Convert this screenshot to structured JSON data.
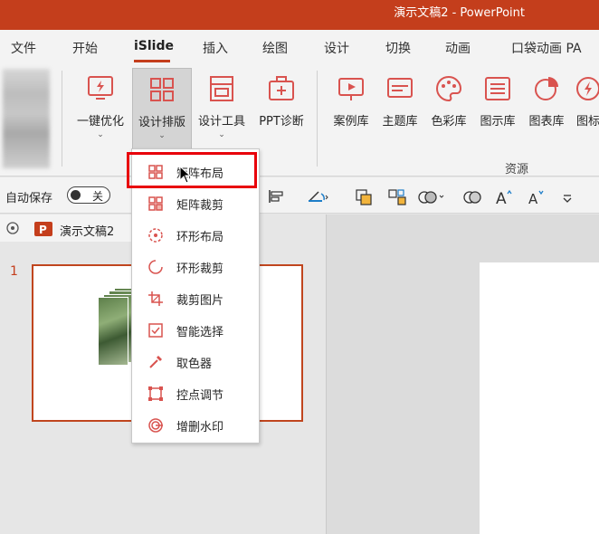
{
  "window": {
    "title": "演示文稿2 - PowerPoint"
  },
  "menu_tabs": [
    "文件",
    "开始",
    "iSlide",
    "插入",
    "绘图",
    "设计",
    "切换",
    "动画",
    "口袋动画 PA"
  ],
  "active_tab": "iSlide",
  "ribbon": {
    "buttons": [
      {
        "label": "一键优化",
        "icon": "lightning-icon"
      },
      {
        "label": "设计排版",
        "icon": "layout-grid-icon"
      },
      {
        "label": "设计工具",
        "icon": "design-tools-icon"
      },
      {
        "label": "PPT诊断",
        "icon": "medical-kit-icon"
      },
      {
        "label": "案例库",
        "icon": "presentation-icon"
      },
      {
        "label": "主题库",
        "icon": "theme-icon"
      },
      {
        "label": "色彩库",
        "icon": "palette-icon"
      },
      {
        "label": "图示库",
        "icon": "diagram-icon"
      },
      {
        "label": "图表库",
        "icon": "pie-chart-icon"
      },
      {
        "label": "图标",
        "icon": "icon-library-icon"
      }
    ],
    "group_resources": "资源"
  },
  "quick_access": {
    "autosave_label": "自动保存",
    "toggle_state": "关"
  },
  "file_tab": {
    "name": "演示文稿2"
  },
  "slide_panel": {
    "slide_number": "1"
  },
  "dropdown": {
    "items": [
      {
        "label": "矩阵布局",
        "icon": "matrix-layout-icon"
      },
      {
        "label": "矩阵裁剪",
        "icon": "matrix-crop-icon"
      },
      {
        "label": "环形布局",
        "icon": "ring-layout-icon"
      },
      {
        "label": "环形裁剪",
        "icon": "ring-crop-icon"
      },
      {
        "label": "裁剪图片",
        "icon": "crop-image-icon"
      },
      {
        "label": "智能选择",
        "icon": "smart-select-icon"
      },
      {
        "label": "取色器",
        "icon": "color-picker-icon"
      },
      {
        "label": "控点调节",
        "icon": "control-points-icon"
      },
      {
        "label": "增删水印",
        "icon": "watermark-icon"
      }
    ]
  },
  "colors": {
    "accent": "#c43e1c",
    "highlight": "#e8000a",
    "icon": "#d9534f"
  }
}
